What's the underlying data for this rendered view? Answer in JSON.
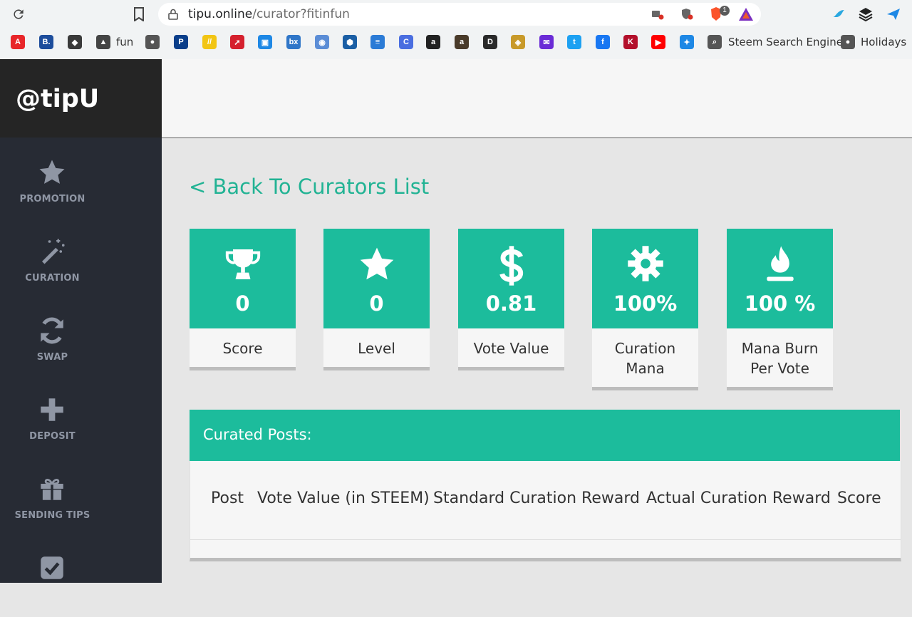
{
  "browser": {
    "url_host": "tipu.online",
    "url_path": "/curator?fitinfun",
    "ext_badge": "1",
    "bookmarks": [
      {
        "label": "",
        "icon": "red-a-icon",
        "color": "#e8262a"
      },
      {
        "label": "",
        "icon": "b-icon",
        "color": "#1d4d9c"
      },
      {
        "label": "",
        "icon": "shield-dark-icon",
        "color": "#3a3a3a"
      },
      {
        "label": "fun",
        "icon": "steem-a-icon",
        "color": "#444444"
      },
      {
        "label": "",
        "icon": "globe-icon",
        "color": "#555555"
      },
      {
        "label": "",
        "icon": "paypal-icon",
        "color": "#0a3e8a"
      },
      {
        "label": "",
        "icon": "yellow-stripes-icon",
        "color": "#f2c514"
      },
      {
        "label": "",
        "icon": "red-swoosh-icon",
        "color": "#d5212e"
      },
      {
        "label": "",
        "icon": "blue-squares-icon",
        "color": "#1e88e5"
      },
      {
        "label": "",
        "icon": "bx-icon",
        "color": "#2f76c8"
      },
      {
        "label": "",
        "icon": "robot-icon",
        "color": "#5b8dd6"
      },
      {
        "label": "",
        "icon": "blue-hex-icon",
        "color": "#1b5fa5"
      },
      {
        "label": "",
        "icon": "lines-icon",
        "color": "#2b7bd6"
      },
      {
        "label": "",
        "icon": "c-circle-icon",
        "color": "#4a6ee0"
      },
      {
        "label": "",
        "icon": "amazon-icon",
        "color": "#222222"
      },
      {
        "label": "",
        "icon": "amazon-box-icon",
        "color": "#4a3b2a"
      },
      {
        "label": "",
        "icon": "d-icon",
        "color": "#2a2a2a"
      },
      {
        "label": "",
        "icon": "tag-icon",
        "color": "#c89a2a"
      },
      {
        "label": "",
        "icon": "mail-icon",
        "color": "#6a2bd6"
      },
      {
        "label": "",
        "icon": "twitter-icon",
        "color": "#1da1f2"
      },
      {
        "label": "",
        "icon": "facebook-icon",
        "color": "#1877f2"
      },
      {
        "label": "",
        "icon": "k-icon",
        "color": "#b3102b"
      },
      {
        "label": "",
        "icon": "youtube-icon",
        "color": "#ff0000"
      },
      {
        "label": "",
        "icon": "runner-icon",
        "color": "#1e88e5"
      },
      {
        "label": "Steem Search Engine",
        "icon": "search-icon",
        "color": "#555555"
      },
      {
        "label": "Holidays",
        "icon": "globe-icon",
        "color": "#555555"
      }
    ]
  },
  "brand": "@tipU",
  "nav": [
    {
      "label": "PROMOTION",
      "icon": "star-icon"
    },
    {
      "label": "CURATION",
      "icon": "magic-wand-icon"
    },
    {
      "label": "SWAP",
      "icon": "refresh-icon"
    },
    {
      "label": "DEPOSIT",
      "icon": "plus-icon"
    },
    {
      "label": "SENDING TIPS",
      "icon": "gift-icon"
    },
    {
      "label": "",
      "icon": "checkbox-icon"
    }
  ],
  "back_link": "< Back To Curators List",
  "stats": [
    {
      "value": "0",
      "label": "Score",
      "icon": "trophy-icon"
    },
    {
      "value": "0",
      "label": "Level",
      "icon": "star-icon"
    },
    {
      "value": "0.81",
      "label": "Vote Value",
      "icon": "dollar-icon"
    },
    {
      "value": "100%",
      "label": "Curation Mana",
      "icon": "gear-icon"
    },
    {
      "value": "100 %",
      "label": "Mana Burn Per Vote",
      "icon": "fire-icon"
    }
  ],
  "posts": {
    "title": "Curated Posts:",
    "columns": [
      "Post",
      "Vote Value (in STEEM)",
      "Standard Curation Reward",
      "Actual Curation Reward",
      "Score"
    ]
  },
  "colors": {
    "accent": "#1cbc9c",
    "sidebar": "#272b34",
    "brand_bg": "#252525"
  }
}
